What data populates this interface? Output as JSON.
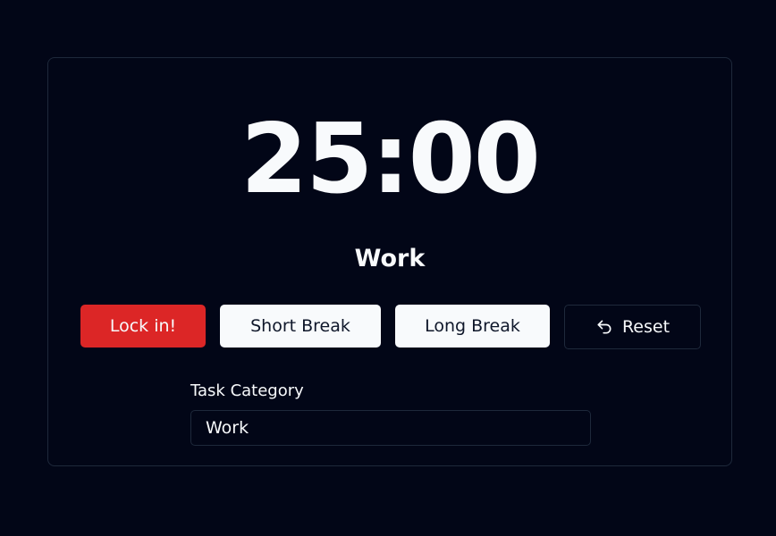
{
  "timer": {
    "display": "25:00",
    "mode_label": "Work"
  },
  "controls": {
    "lock_in_label": "Lock in!",
    "short_break_label": "Short Break",
    "long_break_label": "Long Break",
    "reset_label": "Reset",
    "reset_icon": "undo-arrow-icon"
  },
  "task_category": {
    "label": "Task Category",
    "value": "Work"
  },
  "colors": {
    "background": "#020617",
    "border": "#1e293b",
    "accent_red": "#dc2626",
    "light_button": "#f8fafc",
    "text": "#f8fafc"
  }
}
